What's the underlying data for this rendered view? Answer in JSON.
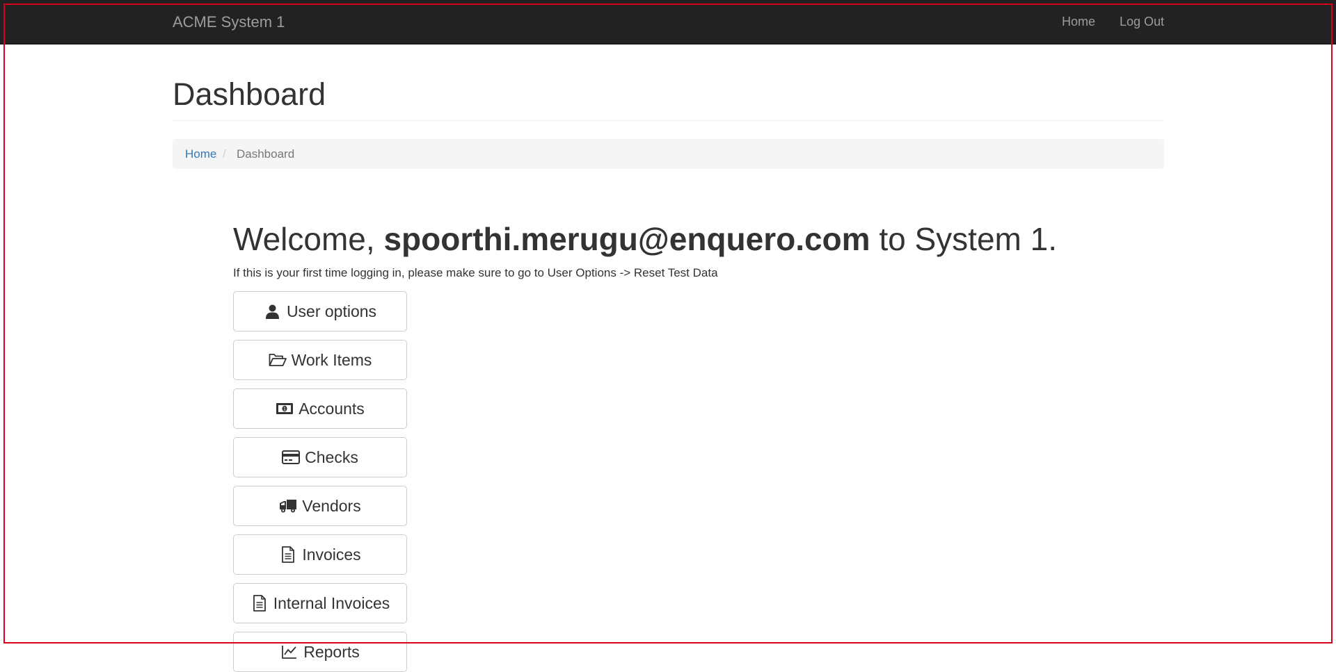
{
  "navbar": {
    "brand": "ACME System 1",
    "links": [
      "Home",
      "Log Out"
    ]
  },
  "page": {
    "title": "Dashboard"
  },
  "breadcrumb": {
    "home": "Home",
    "separator": "/",
    "current": "Dashboard"
  },
  "welcome": {
    "prefix": "Welcome, ",
    "user": "spoorthi.merugu@enquero.com",
    "suffix": " to System 1.",
    "hint": "If this is your first time logging in, please make sure to go to User Options -> Reset Test Data"
  },
  "menu": [
    {
      "label": "User options",
      "icon": "user-icon"
    },
    {
      "label": "Work Items",
      "icon": "folder-open-icon"
    },
    {
      "label": "Accounts",
      "icon": "money-icon"
    },
    {
      "label": "Checks",
      "icon": "credit-card-icon"
    },
    {
      "label": "Vendors",
      "icon": "truck-icon"
    },
    {
      "label": "Invoices",
      "icon": "file-text-icon"
    },
    {
      "label": "Internal Invoices",
      "icon": "file-text-icon"
    },
    {
      "label": "Reports",
      "icon": "chart-icon"
    }
  ],
  "colors": {
    "navbar_bg": "#222222",
    "nav_text": "#9d9d9d",
    "link": "#337ab7",
    "breadcrumb_bg": "#f5f5f5",
    "frame": "#d9001b"
  }
}
